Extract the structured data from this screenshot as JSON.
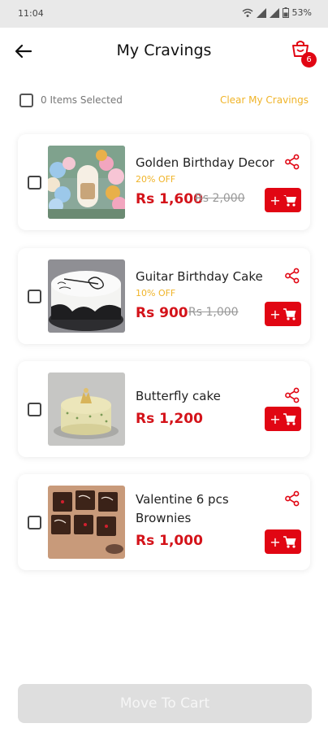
{
  "status": {
    "time": "11:04",
    "battery": "53%"
  },
  "header": {
    "title": "My Cravings",
    "cart_count": "6"
  },
  "selection": {
    "count_label": "0 Items Selected",
    "clear_label": "Clear My Cravings"
  },
  "items": [
    {
      "name": "Golden Birthday Decor",
      "discount": "20% OFF",
      "price": "Rs 1,600",
      "old_price": "Rs 2,000",
      "image": "balloon-decor-photo"
    },
    {
      "name": "Guitar Birthday Cake",
      "discount": "10% OFF",
      "price": "Rs 900",
      "old_price": "Rs 1,000",
      "image": "guitar-cake-photo"
    },
    {
      "name": "Butterfly cake",
      "discount": "",
      "price": "Rs 1,200",
      "old_price": "",
      "image": "butterfly-cake-photo"
    },
    {
      "name": "Valentine 6 pcs Brownies",
      "discount": "",
      "price": "Rs 1,000",
      "old_price": "",
      "image": "brownies-photo"
    }
  ],
  "footer": {
    "move_label": "Move To Cart"
  },
  "colors": {
    "accent_red": "#e10613",
    "discount_gold": "#f0b429",
    "price_red": "#d4131a"
  },
  "icons": [
    "back-arrow-icon",
    "cart-icon",
    "share-icon",
    "add-to-cart-icon",
    "wifi-icon",
    "signal-icon",
    "battery-icon"
  ]
}
